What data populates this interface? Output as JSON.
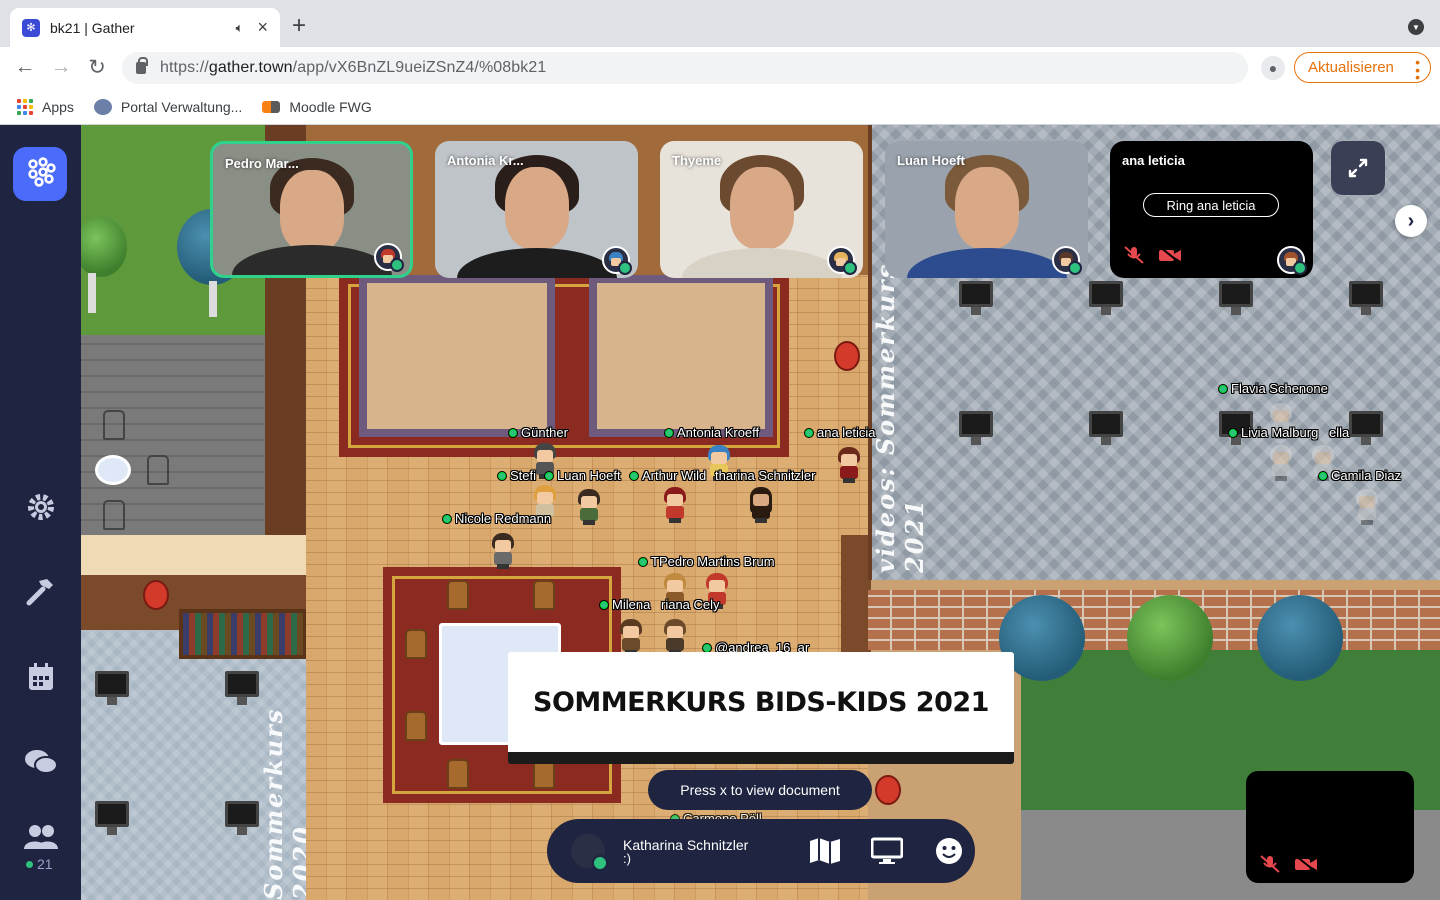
{
  "browser": {
    "tab_title": "bk21 | Gather",
    "url_prefix": "https://",
    "url_host": "gather.town",
    "url_path": "/app/vX6BnZL9ueiZSnZ4/%08bk21",
    "update_label": "Aktualisieren",
    "bookmarks": [
      {
        "label": "Apps",
        "icon": "apps-grid-icon"
      },
      {
        "label": "Portal Verwaltung...",
        "icon": "portal-icon"
      },
      {
        "label": "Moodle FWG",
        "icon": "moodle-icon"
      }
    ]
  },
  "sidebar": {
    "online_count": "21"
  },
  "video_tiles": [
    {
      "name": "Pedro Mar...",
      "hair": "#3a2a20",
      "shirt": "#2b2b2b",
      "bg": "#8a8f86",
      "badge": "#c0392b",
      "active": true
    },
    {
      "name": "Antonia Kr...",
      "hair": "#2a1e1a",
      "shirt": "#1d1d1d",
      "bg": "#bfc4c8",
      "badge": "#3b82c4",
      "active": false
    },
    {
      "name": "Thyeme",
      "hair": "#6b4a30",
      "shirt": "#d8d2c6",
      "bg": "#e7e2da",
      "badge": "#e3b25a",
      "active": false
    },
    {
      "name": "Luan Hoeft",
      "hair": "#7a5a3a",
      "shirt": "#2d4b8f",
      "bg": "#9aa3ad",
      "badge": "#5a3a2a",
      "active": false
    },
    {
      "name": "ana leticia",
      "ring_label": "Ring ana leticia",
      "badge": "#a0522d",
      "camera_off": true
    }
  ],
  "name_labels": [
    {
      "text": "Günther"
    },
    {
      "text": "Antonia Kroeff"
    },
    {
      "text": "ana leticia"
    },
    {
      "text": "Stefi"
    },
    {
      "text": "Luan Hoeft"
    },
    {
      "text": "Arthur Wild"
    },
    {
      "text": "tharina Schnitzler"
    },
    {
      "text": "Nicole Redmann"
    },
    {
      "text": "TPedro Martins Brum"
    },
    {
      "text": "Milena"
    },
    {
      "text": "riana Cely"
    },
    {
      "text": "@andrea_16_ar"
    },
    {
      "text": "Flavia Schenone"
    },
    {
      "text": "Livia Malburg"
    },
    {
      "text": "ella"
    },
    {
      "text": "Camila Diaz"
    },
    {
      "text": "Carmone Pöll"
    }
  ],
  "map_text": {
    "room_2020": "Sommerkurs 2020",
    "room_2021": "videos: Sommerkurs 2021"
  },
  "document": {
    "title": "SOMMERKURS BIDS-KIDS 2021",
    "hint": "Press x to view document"
  },
  "bottom_bar": {
    "user_name": "Katharina Schnitzler",
    "user_status": ":)"
  },
  "colors": {
    "brand": "#4b6bfb",
    "sidebar": "#1f2440",
    "online": "#2ec27e",
    "update_orange": "#e8710a"
  }
}
